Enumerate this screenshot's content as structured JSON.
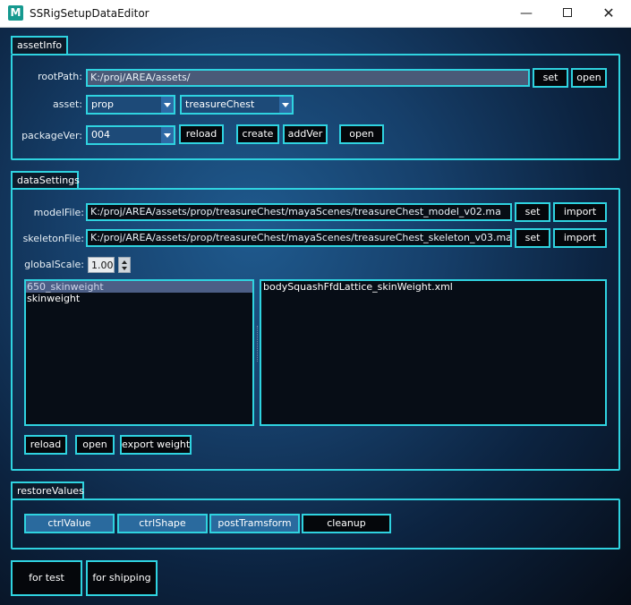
{
  "window": {
    "title": "SSRigSetupDataEditor",
    "minimize_glyph": "—",
    "close_glyph": "✕",
    "icon_letter": "M",
    "accent_color": "#2fd3e0"
  },
  "assetInfo": {
    "group_label": "assetInfo",
    "rootPath_label": "rootPath:",
    "rootPath_value": "K:/proj/AREA/assets/",
    "set_label": "set",
    "open_label": "open",
    "asset_label": "asset:",
    "asset_type": "prop",
    "asset_name": "treasureChest",
    "packageVer_label": "packageVer:",
    "packageVer_value": "004",
    "reload_label": "reload",
    "create_label": "create",
    "addVer_label": "addVer",
    "open2_label": "open"
  },
  "dataSettings": {
    "group_label": "dataSettings",
    "modelFile_label": "modelFile:",
    "modelFile_value": "K:/proj/AREA/assets/prop/treasureChest/mayaScenes/treasureChest_model_v02.ma",
    "skeletonFile_label": "skeletonFile:",
    "skeletonFile_value": "K:/proj/AREA/assets/prop/treasureChest/mayaScenes/treasureChest_skeleton_v03.ma",
    "set_label": "set",
    "import_label": "import",
    "globalScale_label": "globalScale:",
    "globalScale_value": "1.00",
    "left_list": [
      "650_skinweight",
      "skinweight"
    ],
    "right_list": [
      "bodySquashFfdLattice_skinWeight.xml"
    ],
    "reload_label": "reload",
    "open_label": "open",
    "export_weight_label": "export weight"
  },
  "restoreValues": {
    "group_label": "restoreValues",
    "ctrlValue_label": "ctrlValue",
    "ctrlShape_label": "ctrlShape",
    "postTramsform_label": "postTramsform",
    "cleanup_label": "cleanup"
  },
  "footer": {
    "for_test_label": "for test",
    "for_shipping_label": "for shipping"
  }
}
